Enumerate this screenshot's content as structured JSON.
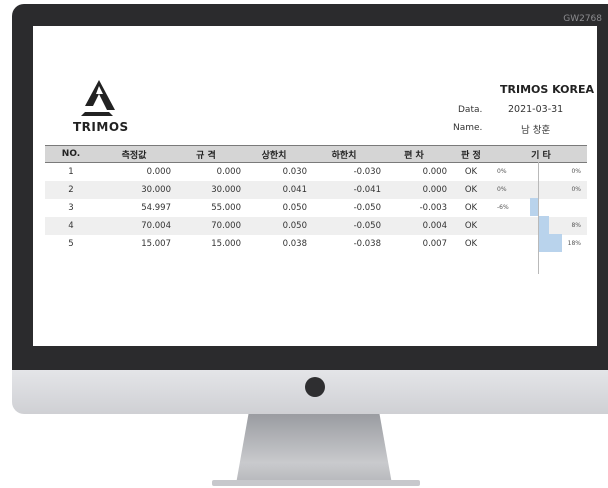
{
  "model_code": "GW2768",
  "logo": {
    "text": "TRIMOS"
  },
  "company": "TRIMOS KOREA",
  "info": {
    "date_label": "Data.",
    "date_value": "2021-03-31",
    "name_label": "Name.",
    "name_value": "남 창훈"
  },
  "table": {
    "headers": [
      "NO.",
      "측정값",
      "규 격",
      "상한치",
      "하한치",
      "편 차",
      "판 정",
      "기 타"
    ],
    "rows": [
      {
        "no": "1",
        "measured": "0.000",
        "spec": "0.000",
        "upper": "0.030",
        "lower": "-0.030",
        "deviation": "0.000",
        "judge": "OK",
        "pct_left": "0%",
        "pct_right": "0%",
        "bar_pct": 0
      },
      {
        "no": "2",
        "measured": "30.000",
        "spec": "30.000",
        "upper": "0.041",
        "lower": "-0.041",
        "deviation": "0.000",
        "judge": "OK",
        "pct_left": "0%",
        "pct_right": "0%",
        "bar_pct": 0
      },
      {
        "no": "3",
        "measured": "54.997",
        "spec": "55.000",
        "upper": "0.050",
        "lower": "-0.050",
        "deviation": "-0.003",
        "judge": "OK",
        "pct_left": "-6%",
        "pct_right": "",
        "bar_pct": -6
      },
      {
        "no": "4",
        "measured": "70.004",
        "spec": "70.000",
        "upper": "0.050",
        "lower": "-0.050",
        "deviation": "0.004",
        "judge": "OK",
        "pct_left": "",
        "pct_right": "8%",
        "bar_pct": 8
      },
      {
        "no": "5",
        "measured": "15.007",
        "spec": "15.000",
        "upper": "0.038",
        "lower": "-0.038",
        "deviation": "0.007",
        "judge": "OK",
        "pct_left": "",
        "pct_right": "18%",
        "bar_pct": 18
      }
    ]
  },
  "colors": {
    "bar": "#b9d3ec",
    "header_bg": "#d5d5d5",
    "row_alt": "#efefef",
    "monitor": "#2b2b2d"
  }
}
